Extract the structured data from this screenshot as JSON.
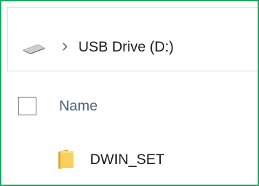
{
  "breadcrumb": {
    "drive_icon": "removable-drive-icon",
    "separator_icon": "chevron-right-icon",
    "location": "USB Drive (D:)"
  },
  "file_list": {
    "column_header": "Name",
    "items": [
      {
        "icon": "folder-icon",
        "name": "DWIN_SET"
      }
    ]
  },
  "colors": {
    "frame_border": "#19a463",
    "folder": "#f4c542",
    "header_text": "#4c607a"
  }
}
